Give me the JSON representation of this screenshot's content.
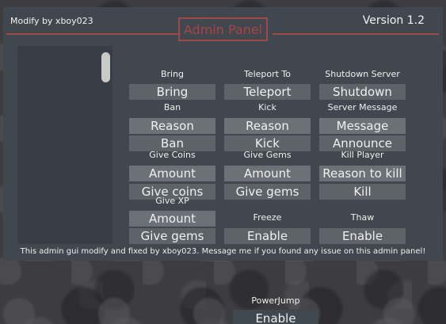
{
  "header": {
    "modify_by": "Modify by xboy023",
    "version": "Version 1.2",
    "title": "Admin Panel"
  },
  "labels": {
    "bring": "Bring",
    "teleport_to": "Teleport To",
    "shutdown_server": "Shutdown Server",
    "ban": "Ban",
    "kick": "Kick",
    "server_message": "Server Message",
    "give_coins": "Give Coins",
    "give_gems": "Give Gems",
    "kill_player": "Kill Player",
    "give_xp": "Give XP",
    "freeze": "Freeze",
    "thaw": "Thaw"
  },
  "buttons": {
    "bring": "Bring",
    "teleport": "Teleport",
    "shutdown": "Shutdown",
    "ban_reason": "Reason",
    "ban": "Ban",
    "kick_reason": "Reason",
    "kick": "Kick",
    "message": "Message",
    "announce": "Announce",
    "coins_amount": "Amount",
    "give_coins": "Give coins",
    "gems_amount": "Amount",
    "give_gems": "Give gems",
    "reason_to_kill": "Reason to kill",
    "kill": "Kill",
    "xp_amount": "Amount",
    "give_xp": "Give gems",
    "freeze": "Enable",
    "thaw": "Enable"
  },
  "footer": "This admin gui modify and fixed by xboy023.  Message me if you found any issue on this admin panel!",
  "power_jump": {
    "label": "PowerJump",
    "button": "Enable"
  }
}
